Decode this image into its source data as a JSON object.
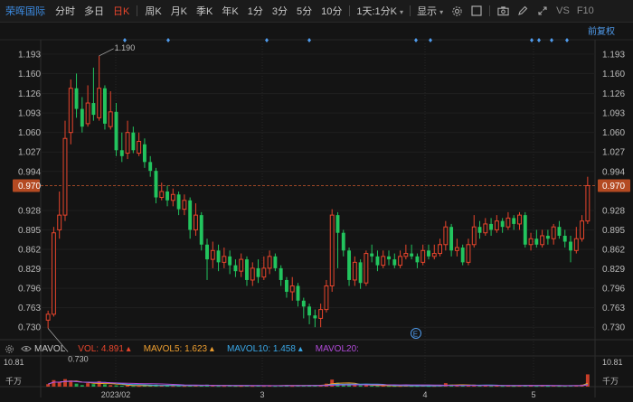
{
  "toolbar": {
    "stock_name": "荣晖国际",
    "tabs": [
      "分时",
      "多日",
      "日K",
      "周K",
      "月K",
      "季K",
      "年K",
      "1分",
      "3分",
      "5分",
      "10分"
    ],
    "active_tab": "日K",
    "period_dropdown": "1天:1分K",
    "display_dropdown": "显示",
    "vs_text": "VS",
    "f10_text": "F10"
  },
  "adjust_label": "前复权",
  "price_axis": {
    "ticks": [
      "1.193",
      "1.160",
      "1.126",
      "1.093",
      "1.060",
      "1.027",
      "0.994",
      "0.970",
      "0.928",
      "0.895",
      "0.862",
      "0.829",
      "0.796",
      "0.763",
      "0.730"
    ],
    "current_price": "0.970",
    "high_label": "1.190",
    "low_label": "0.730"
  },
  "volume_axis": {
    "top": "10.81",
    "unit": "千万"
  },
  "date_labels": [
    "2023/02",
    "3",
    "4",
    "5"
  ],
  "legend": {
    "name": "MAVOL",
    "vol": "VOL:",
    "vol_val": "4.891",
    "ma5": "MAVOL5:",
    "ma5_val": "1.623",
    "ma10": "MAVOL10:",
    "ma10_val": "1.458",
    "ma20": "MAVOL20:"
  },
  "colors": {
    "up": "#e8452c",
    "down": "#22c45e",
    "ma5": "#f0a030",
    "ma10": "#3aa8e8",
    "ma20": "#b04ad8",
    "accent": "#3d8ee6"
  },
  "event_marker": "E",
  "chart_data": {
    "type": "candlestick",
    "ylim": [
      0.715,
      1.205
    ],
    "candles": [
      [
        0.742,
        0.752,
        0.758,
        0.728
      ],
      [
        0.752,
        0.89,
        0.9,
        0.748
      ],
      [
        0.895,
        0.92,
        0.96,
        0.88
      ],
      [
        0.92,
        1.05,
        1.08,
        0.91
      ],
      [
        1.06,
        1.135,
        1.15,
        1.04
      ],
      [
        1.135,
        1.1,
        1.16,
        1.085
      ],
      [
        1.1,
        1.07,
        1.12,
        1.06
      ],
      [
        1.075,
        1.11,
        1.14,
        1.07
      ],
      [
        1.11,
        1.09,
        1.17,
        1.08
      ],
      [
        1.085,
        1.135,
        1.19,
        1.08
      ],
      [
        1.135,
        1.075,
        1.14,
        1.065
      ],
      [
        1.07,
        1.095,
        1.13,
        1.065
      ],
      [
        1.095,
        1.03,
        1.11,
        1.02
      ],
      [
        1.03,
        1.02,
        1.06,
        1.01
      ],
      [
        1.025,
        1.06,
        1.08,
        1.015
      ],
      [
        1.06,
        1.03,
        1.07,
        1.025
      ],
      [
        1.025,
        1.045,
        1.06,
        1.02
      ],
      [
        1.04,
        1.01,
        1.05,
        1.0
      ],
      [
        1.01,
        0.995,
        1.02,
        0.985
      ],
      [
        0.995,
        0.95,
        1.0,
        0.94
      ],
      [
        0.95,
        0.96,
        0.975,
        0.945
      ],
      [
        0.96,
        0.945,
        0.97,
        0.935
      ],
      [
        0.945,
        0.955,
        0.965,
        0.935
      ],
      [
        0.955,
        0.93,
        0.96,
        0.92
      ],
      [
        0.93,
        0.945,
        0.955,
        0.92
      ],
      [
        0.945,
        0.895,
        0.95,
        0.88
      ],
      [
        0.895,
        0.92,
        0.94,
        0.885
      ],
      [
        0.92,
        0.87,
        0.925,
        0.86
      ],
      [
        0.87,
        0.845,
        0.88,
        0.81
      ],
      [
        0.845,
        0.86,
        0.875,
        0.83
      ],
      [
        0.86,
        0.84,
        0.87,
        0.825
      ],
      [
        0.84,
        0.85,
        0.865,
        0.83
      ],
      [
        0.85,
        0.835,
        0.86,
        0.82
      ],
      [
        0.835,
        0.825,
        0.845,
        0.815
      ],
      [
        0.825,
        0.845,
        0.855,
        0.815
      ],
      [
        0.845,
        0.81,
        0.85,
        0.8
      ],
      [
        0.81,
        0.83,
        0.84,
        0.8
      ],
      [
        0.83,
        0.815,
        0.845,
        0.805
      ],
      [
        0.815,
        0.83,
        0.85,
        0.81
      ],
      [
        0.83,
        0.85,
        0.86,
        0.82
      ],
      [
        0.85,
        0.83,
        0.855,
        0.825
      ],
      [
        0.83,
        0.81,
        0.835,
        0.8
      ],
      [
        0.81,
        0.79,
        0.815,
        0.78
      ],
      [
        0.79,
        0.8,
        0.815,
        0.775
      ],
      [
        0.8,
        0.775,
        0.805,
        0.765
      ],
      [
        0.775,
        0.765,
        0.78,
        0.745
      ],
      [
        0.765,
        0.75,
        0.77,
        0.735
      ],
      [
        0.75,
        0.745,
        0.76,
        0.73
      ],
      [
        0.745,
        0.76,
        0.77,
        0.73
      ],
      [
        0.76,
        0.8,
        0.81,
        0.755
      ],
      [
        0.8,
        0.92,
        0.93,
        0.79
      ],
      [
        0.92,
        0.89,
        0.925,
        0.83
      ],
      [
        0.89,
        0.86,
        0.895,
        0.85
      ],
      [
        0.86,
        0.81,
        0.865,
        0.8
      ],
      [
        0.81,
        0.84,
        0.85,
        0.8
      ],
      [
        0.84,
        0.805,
        0.845,
        0.795
      ],
      [
        0.805,
        0.855,
        0.86,
        0.8
      ],
      [
        0.855,
        0.85,
        0.87,
        0.84
      ],
      [
        0.85,
        0.835,
        0.86,
        0.825
      ],
      [
        0.835,
        0.85,
        0.86,
        0.83
      ],
      [
        0.85,
        0.845,
        0.86,
        0.835
      ],
      [
        0.845,
        0.835,
        0.855,
        0.83
      ],
      [
        0.835,
        0.85,
        0.86,
        0.83
      ],
      [
        0.85,
        0.855,
        0.87,
        0.845
      ],
      [
        0.855,
        0.85,
        0.87,
        0.845
      ],
      [
        0.85,
        0.84,
        0.855,
        0.83
      ],
      [
        0.84,
        0.86,
        0.87,
        0.835
      ],
      [
        0.86,
        0.85,
        0.87,
        0.845
      ],
      [
        0.85,
        0.855,
        0.87,
        0.845
      ],
      [
        0.855,
        0.87,
        0.88,
        0.85
      ],
      [
        0.87,
        0.9,
        0.91,
        0.86
      ],
      [
        0.9,
        0.86,
        0.905,
        0.85
      ],
      [
        0.86,
        0.865,
        0.88,
        0.85
      ],
      [
        0.865,
        0.84,
        0.87,
        0.835
      ],
      [
        0.84,
        0.87,
        0.88,
        0.835
      ],
      [
        0.87,
        0.9,
        0.92,
        0.865
      ],
      [
        0.9,
        0.89,
        0.91,
        0.88
      ],
      [
        0.89,
        0.905,
        0.915,
        0.885
      ],
      [
        0.905,
        0.895,
        0.915,
        0.885
      ],
      [
        0.895,
        0.91,
        0.92,
        0.89
      ],
      [
        0.91,
        0.9,
        0.915,
        0.89
      ],
      [
        0.9,
        0.915,
        0.925,
        0.895
      ],
      [
        0.915,
        0.905,
        0.92,
        0.895
      ],
      [
        0.905,
        0.92,
        0.925,
        0.895
      ],
      [
        0.92,
        0.87,
        0.925,
        0.865
      ],
      [
        0.87,
        0.88,
        0.89,
        0.86
      ],
      [
        0.88,
        0.87,
        0.895,
        0.865
      ],
      [
        0.87,
        0.885,
        0.895,
        0.865
      ],
      [
        0.885,
        0.88,
        0.895,
        0.87
      ],
      [
        0.88,
        0.9,
        0.905,
        0.87
      ],
      [
        0.9,
        0.885,
        0.91,
        0.88
      ],
      [
        0.885,
        0.875,
        0.895,
        0.865
      ],
      [
        0.875,
        0.86,
        0.885,
        0.84
      ],
      [
        0.86,
        0.88,
        0.9,
        0.855
      ],
      [
        0.88,
        0.91,
        0.92,
        0.875
      ],
      [
        0.91,
        0.97,
        0.985,
        0.905
      ]
    ],
    "volume_ylim": [
      0,
      10.81
    ],
    "volumes": [
      1.0,
      2.6,
      1.8,
      3.0,
      2.5,
      1.2,
      0.6,
      1.4,
      1.0,
      2.2,
      0.9,
      0.6,
      0.5,
      0.4,
      0.5,
      0.3,
      0.3,
      0.4,
      0.5,
      0.8,
      0.4,
      0.5,
      0.3,
      0.4,
      0.3,
      0.6,
      0.4,
      0.5,
      0.8,
      0.4,
      0.3,
      0.3,
      0.4,
      0.3,
      0.3,
      0.5,
      0.3,
      0.4,
      0.3,
      0.5,
      0.3,
      0.4,
      0.6,
      0.3,
      0.5,
      0.4,
      0.5,
      0.6,
      0.7,
      1.2,
      2.8,
      1.6,
      0.9,
      0.8,
      0.6,
      0.5,
      0.6,
      0.4,
      0.3,
      0.4,
      0.3,
      0.3,
      0.3,
      0.4,
      0.3,
      0.3,
      0.4,
      0.3,
      0.3,
      0.5,
      1.4,
      0.8,
      0.4,
      0.5,
      0.4,
      0.8,
      0.5,
      0.4,
      0.3,
      0.4,
      0.3,
      0.4,
      0.3,
      0.4,
      0.6,
      0.4,
      0.3,
      0.4,
      0.3,
      0.4,
      0.3,
      0.3,
      0.5,
      0.4,
      0.8,
      4.891
    ]
  }
}
